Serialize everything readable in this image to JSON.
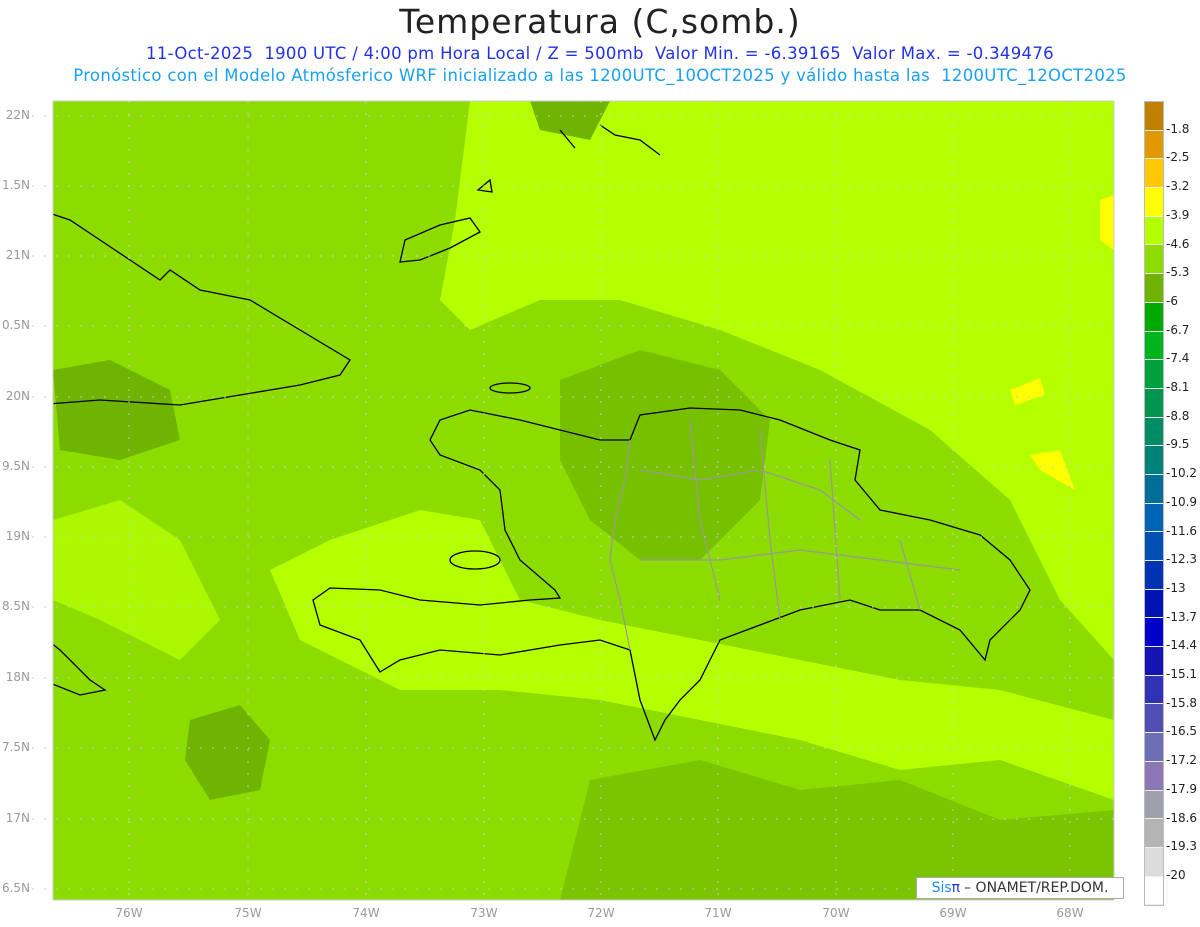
{
  "header": {
    "title": "Temperatura (C,somb.)",
    "line1": "11-Oct-2025  1900 UTC / 4:00 pm Hora Local / Z = 500mb  Valor Min. = -6.39165  Valor Max. = -0.349476",
    "line2": "Pronóstico con el Modelo Atmósferico WRF inicializado a las 1200UTC_10OCT2025 y válido hasta las  1200UTC_12OCT2025"
  },
  "axes": {
    "lat_labels": [
      "22N",
      "1.5N",
      "21N",
      "0.5N",
      "20N",
      "9.5N",
      "19N",
      "8.5N",
      "18N",
      "7.5N",
      "17N",
      "6.5N"
    ],
    "lon_labels": [
      "76W",
      "75W",
      "74W",
      "73W",
      "72W",
      "71W",
      "70W",
      "69W",
      "68W"
    ]
  },
  "colorbar": {
    "labels": [
      "-1.8",
      "-2.5",
      "-3.2",
      "-3.9",
      "-4.6",
      "-5.3",
      "-6",
      "-6.7",
      "-7.4",
      "-8.1",
      "-8.8",
      "-9.5",
      "-10.2",
      "-10.9",
      "-11.6",
      "-12.3",
      "-13",
      "-13.7",
      "-14.4",
      "-15.1",
      "-15.8",
      "-16.5",
      "-17.2",
      "-17.9",
      "-18.6",
      "-19.3",
      "-20"
    ],
    "colors": [
      "#c08000",
      "#e09a00",
      "#ffc800",
      "#ffff00",
      "#b4ff00",
      "#8cdc00",
      "#6eb400",
      "#00aa00",
      "#00b41e",
      "#00a03c",
      "#009650",
      "#008c64",
      "#008278",
      "#006e96",
      "#0064b4",
      "#0050b4",
      "#0032b4",
      "#0014b4",
      "#0000c8",
      "#1414b4",
      "#3232b4",
      "#5050b4",
      "#6e6eb4",
      "#8c78b4",
      "#a0a0aa",
      "#b4b4b4",
      "#dcdcdc",
      "#ffffff"
    ]
  },
  "credit": {
    "logo": "Sis",
    "logo_pi": "π",
    "text": " – ONAMET/REP.DOM."
  },
  "colors": {
    "base": "#8cdc00",
    "light": "#b4ff00",
    "dark": "#6eb400",
    "yellow": "#ffff00"
  }
}
